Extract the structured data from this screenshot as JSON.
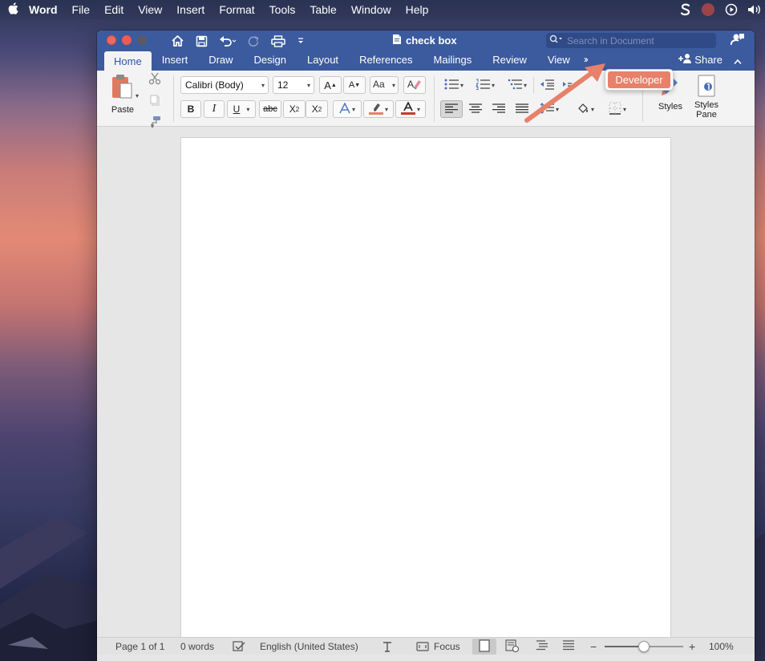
{
  "menubar": {
    "app_name": "Word",
    "items": [
      "File",
      "Edit",
      "View",
      "Insert",
      "Format",
      "Tools",
      "Table",
      "Window",
      "Help"
    ]
  },
  "titlebar": {
    "doc_title": "check box",
    "search_placeholder": "Search in Document"
  },
  "tabs": [
    "Home",
    "Insert",
    "Draw",
    "Design",
    "Layout",
    "References",
    "Mailings",
    "Review",
    "View"
  ],
  "active_tab": "Home",
  "tabs_overflow": "››",
  "share_label": "Share",
  "developer_popup": "Developer",
  "ribbon": {
    "paste_label": "Paste",
    "font_name": "Calibri (Body)",
    "font_size": "12",
    "bold": "B",
    "italic": "I",
    "underline": "U",
    "strike": "abc",
    "subscript": "X",
    "subscript_mark": "2",
    "superscript": "X",
    "superscript_mark": "2",
    "grow_font": "A",
    "shrink_font": "A",
    "styles_label": "Styles",
    "styles_pane_label": "Styles Pane"
  },
  "statusbar": {
    "page": "Page 1 of 1",
    "words": "0 words",
    "language": "English (United States)",
    "focus": "Focus",
    "zoom_level": "100%",
    "zoom_minus": "−",
    "zoom_plus": "+",
    "zoom_fraction": 0.5
  },
  "colors": {
    "word_blue": "#3c5a9e",
    "active_tab_text": "#2f56a7",
    "arrow": "#e8806a",
    "highlight_bar": "#e8806a",
    "font_color_bar": "#c83a30"
  }
}
